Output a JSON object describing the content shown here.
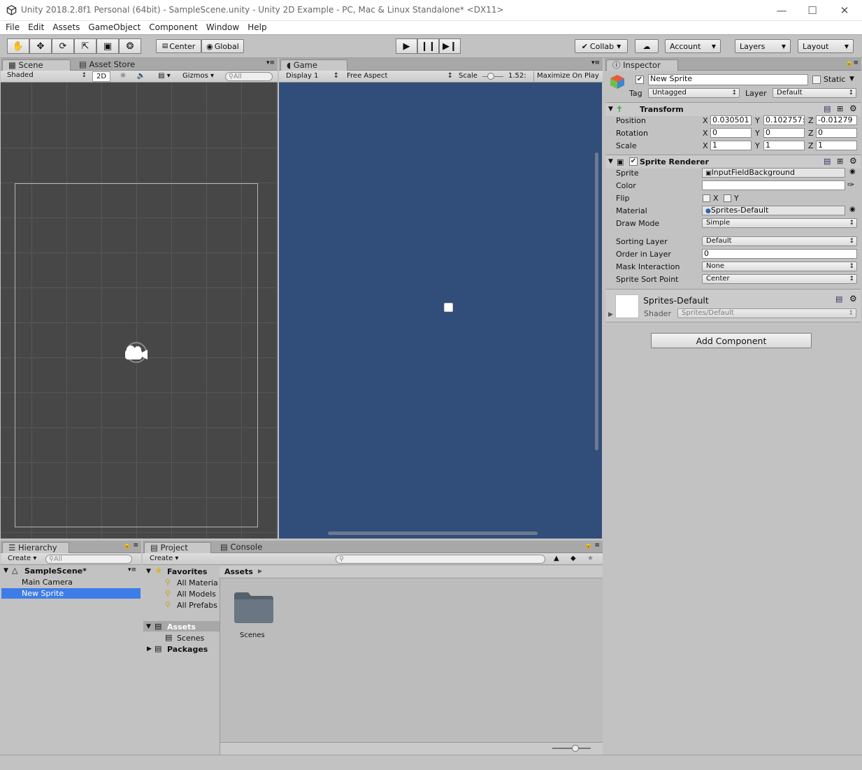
{
  "window": {
    "title": "Unity 2018.2.8f1 Personal (64bit) - SampleScene.unity - Unity 2D Example - PC, Mac & Linux Standalone* <DX11>",
    "logo_icon": "unity-logo-icon"
  },
  "menu": [
    "File",
    "Edit",
    "Assets",
    "GameObject",
    "Component",
    "Window",
    "Help"
  ],
  "toolbar": {
    "pivot": "Center",
    "space": "Global",
    "collab": "Collab",
    "account": "Account",
    "layers": "Layers",
    "layout": "Layout"
  },
  "scene": {
    "tab": "Scene",
    "tab2": "Asset Store",
    "shading": "Shaded",
    "mode2d": "2D",
    "gizmos": "Gizmos",
    "search": "All"
  },
  "game": {
    "tab": "Game",
    "display": "Display 1",
    "aspect": "Free Aspect",
    "scale_label": "Scale",
    "scale_value": "1.52:",
    "maximize": "Maximize On Play",
    "bg": "#314d79"
  },
  "inspector": {
    "tab": "Inspector",
    "name": "New Sprite",
    "static": "Static",
    "tag_label": "Tag",
    "tag": "Untagged",
    "layer_label": "Layer",
    "layer": "Default",
    "transform": {
      "title": "Transform",
      "position_label": "Position",
      "rotation_label": "Rotation",
      "scale_label": "Scale",
      "axis_x": "X",
      "axis_y": "Y",
      "axis_z": "Z",
      "pos": [
        "0.030501",
        "0.102757:",
        "-0.01279"
      ],
      "rot": [
        "0",
        "0",
        "0"
      ],
      "scl": [
        "1",
        "1",
        "1"
      ]
    },
    "sprite_renderer": {
      "title": "Sprite Renderer",
      "sprite_label": "Sprite",
      "sprite": "InputFieldBackground",
      "color_label": "Color",
      "flip_label": "Flip",
      "flip_x": "X",
      "flip_y": "Y",
      "material_label": "Material",
      "material": "Sprites-Default",
      "draw_mode_label": "Draw Mode",
      "draw_mode": "Simple",
      "sorting_layer_label": "Sorting Layer",
      "sorting_layer": "Default",
      "order_label": "Order in Layer",
      "order": "0",
      "mask_label": "Mask Interaction",
      "mask": "None",
      "sort_point_label": "Sprite Sort Point",
      "sort_point": "Center"
    },
    "material": {
      "name": "Sprites-Default",
      "shader_label": "Shader",
      "shader": "Sprites/Default"
    },
    "add_component": "Add Component"
  },
  "hierarchy": {
    "tab": "Hierarchy",
    "create": "Create",
    "search": "All",
    "scene": "SampleScene*",
    "items": [
      "Main Camera",
      "New Sprite"
    ],
    "selected": "New Sprite"
  },
  "project": {
    "tab": "Project",
    "tab2": "Console",
    "create": "Create",
    "breadcrumb": "Assets",
    "favorites": "Favorites",
    "fav_items": [
      "All Materia",
      "All Models",
      "All Prefabs"
    ],
    "assets": "Assets",
    "asset_children": [
      "Scenes"
    ],
    "packages": "Packages",
    "grid_items": [
      "Scenes"
    ]
  }
}
